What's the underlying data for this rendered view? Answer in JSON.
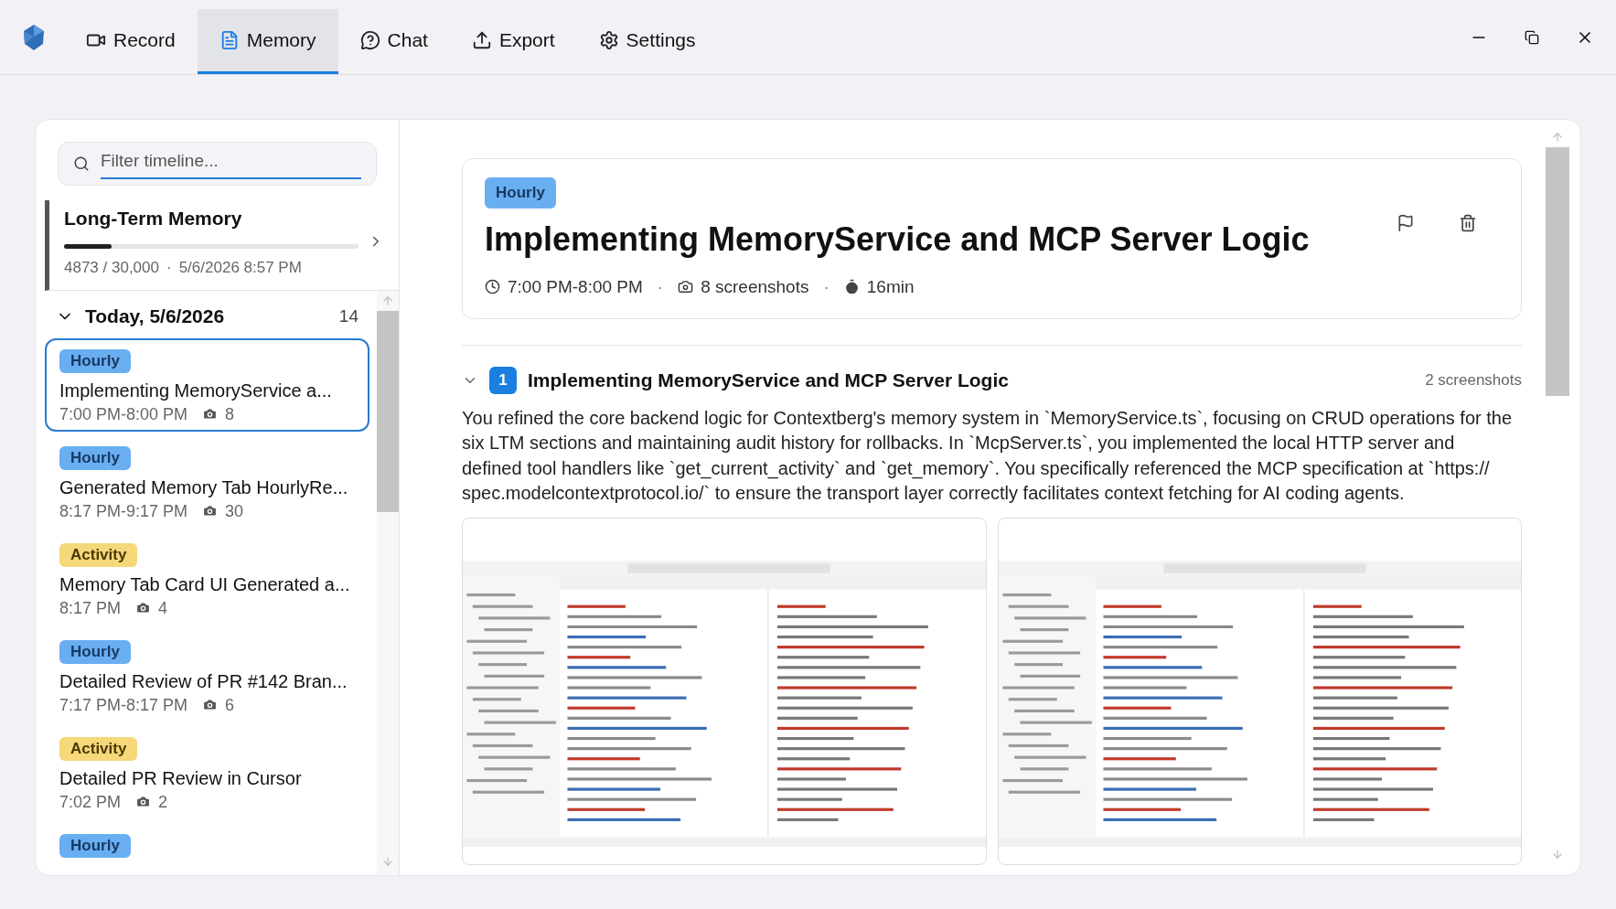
{
  "tabs": [
    {
      "label": "Record",
      "selected": false
    },
    {
      "label": "Memory",
      "selected": true
    },
    {
      "label": "Chat",
      "selected": false
    },
    {
      "label": "Export",
      "selected": false
    },
    {
      "label": "Settings",
      "selected": false
    }
  ],
  "filter": {
    "placeholder": "Filter timeline..."
  },
  "long_term_memory": {
    "title": "Long-Term Memory",
    "level": 0.16,
    "usage": "4873 / 30,000",
    "separator": "·",
    "updated": "5/6/2026 8:57 PM"
  },
  "group": {
    "title": "Today, 5/6/2026",
    "count": "14",
    "expanded": true
  },
  "items": [
    {
      "kind": "hourly",
      "badge": "Hourly",
      "title": "Implementing MemoryService a...",
      "time": "7:00 PM-8:00 PM",
      "shots": "8",
      "selected": true
    },
    {
      "kind": "hourly",
      "badge": "Hourly",
      "title": "Generated Memory Tab HourlyRe...",
      "time": "8:17 PM-9:17 PM",
      "shots": "30",
      "selected": false
    },
    {
      "kind": "activity",
      "badge": "Activity",
      "title": "Memory Tab Card UI Generated a...",
      "time": "8:17 PM",
      "shots": "4",
      "selected": false
    },
    {
      "kind": "hourly",
      "badge": "Hourly",
      "title": "Detailed Review of PR #142 Bran...",
      "time": "7:17 PM-8:17 PM",
      "shots": "6",
      "selected": false
    },
    {
      "kind": "activity",
      "badge": "Activity",
      "title": "Detailed PR Review in Cursor",
      "time": "7:02 PM",
      "shots": "2",
      "selected": false
    },
    {
      "kind": "hourly",
      "badge": "Hourly",
      "selected": false
    }
  ],
  "detail": {
    "kind": "hourly",
    "badge": "Hourly",
    "title": "Implementing MemoryService and MCP Server Logic",
    "time": "7:00 PM-8:00 PM",
    "screenshots": "8 screenshots",
    "duration": "16min",
    "separator": "·"
  },
  "section": {
    "number": "1",
    "title": "Implementing MemoryService and MCP Server Logic",
    "count": "2 screenshots",
    "expanded": true,
    "body": "You refined the core backend logic for Contextberg's memory system in `MemoryService.ts`, focusing on CRUD operations for the six LTM sections and maintaining audit history for rollbacks. In `McpServer.ts`, you implemented the local HTTP server and defined tool handlers like `get_current_activity` and `get_memory`. You specifically referenced the MCP specification at `https:// spec.modelcontextprotocol.io/` to ensure the transport layer correctly facilitates context fetching for AI coding agents."
  }
}
